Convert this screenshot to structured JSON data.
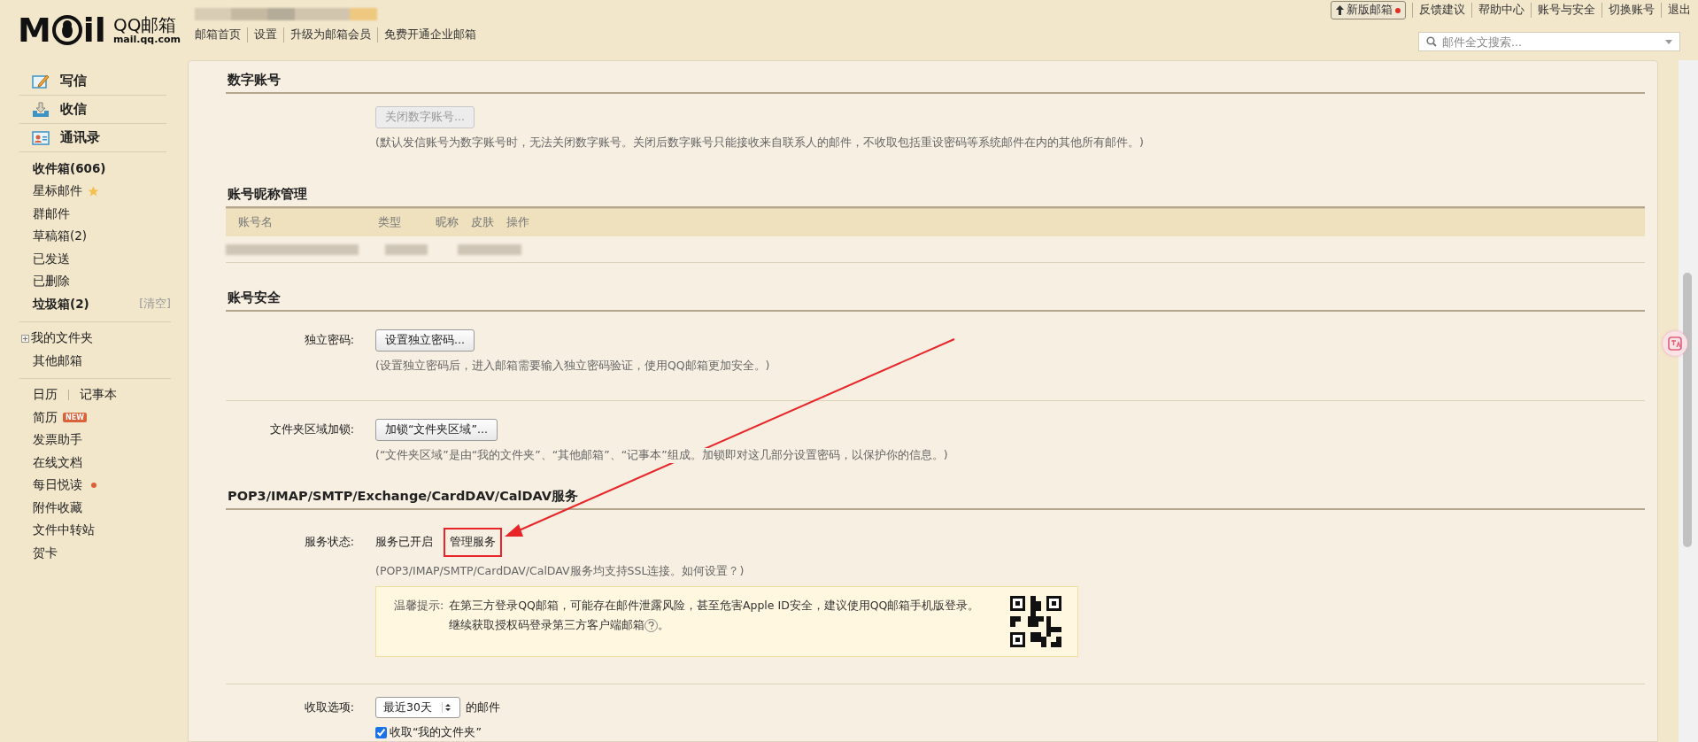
{
  "header": {
    "logo": {
      "letters_left": "M",
      "letters_right": "il",
      "name": "QQ邮箱",
      "domain": "mail.qq.com"
    },
    "nav_links": [
      "邮箱首页",
      "设置",
      "升级为邮箱会员",
      "免费开通企业邮箱"
    ],
    "new_version_button": {
      "label": "新版邮箱",
      "notify": true
    },
    "top_links": [
      "反馈建议",
      "帮助中心",
      "账号与安全",
      "切换账号",
      "退出"
    ],
    "search": {
      "placeholder": "邮件全文搜索..."
    }
  },
  "sidebar": {
    "actions": [
      {
        "label": "写信",
        "kind": "compose"
      },
      {
        "label": "收信",
        "kind": "inbox"
      },
      {
        "label": "通讯录",
        "kind": "contacts"
      }
    ],
    "folders": [
      {
        "label": "收件箱(606)",
        "unread": true,
        "starred": false
      },
      {
        "label": "星标邮件",
        "unread": false,
        "starred": true
      },
      {
        "label": "群邮件",
        "unread": false,
        "starred": false
      },
      {
        "label": "草稿箱(2)",
        "unread": false,
        "starred": false
      },
      {
        "label": "已发送",
        "unread": false,
        "starred": false
      },
      {
        "label": "已删除",
        "unread": false,
        "starred": false
      },
      {
        "label": "垃圾箱(2)",
        "unread": true,
        "starred": false,
        "action": "[清空]"
      }
    ],
    "my_folders": {
      "label": "我的文件夹",
      "expanded": false
    },
    "other_mail": "其他邮箱",
    "calendar_links": [
      "日历",
      "记事本"
    ],
    "tools": [
      {
        "label": "简历",
        "badge": "NEW",
        "notify": false
      },
      {
        "label": "发票助手",
        "notify": false
      },
      {
        "label": "在线文档",
        "notify": false
      },
      {
        "label": "每日悦读",
        "notify": true
      },
      {
        "label": "附件收藏",
        "notify": false
      },
      {
        "label": "文件中转站",
        "notify": false
      },
      {
        "label": "贺卡",
        "notify": false
      }
    ]
  },
  "content": {
    "digital_account": {
      "title": "数字账号",
      "button": {
        "label": "关闭数字账号...",
        "disabled": true
      },
      "note": "(默认发信账号为数字账号时，无法关闭数字账号。关闭后数字账号只能接收来自联系人的邮件，不收取包括重设密码等系统邮件在内的其他所有邮件。)"
    },
    "nickname": {
      "title": "账号昵称管理",
      "columns": [
        "账号名",
        "类型",
        "昵称",
        "皮肤",
        "操作"
      ]
    },
    "security": {
      "title": "账号安全",
      "rows": [
        {
          "label": "独立密码:",
          "button": {
            "label": "设置独立密码...",
            "disabled": false
          },
          "note": "(设置独立密码后，进入邮箱需要输入独立密码验证，使用QQ邮箱更加安全。)"
        },
        {
          "label": "文件夹区域加锁:",
          "button": {
            "label": "加锁“文件夹区域”...",
            "disabled": false
          },
          "note": "(“文件夹区域”是由“我的文件夹”、“其他邮箱”、“记事本”组成。加锁即对这几部分设置密码，以保护你的信息。)"
        }
      ]
    },
    "services": {
      "title": "POP3/IMAP/SMTP/Exchange/CardDAV/CalDAV服务",
      "status_label": "服务状态:",
      "status_value": "服务已开启",
      "manage_link": "管理服务",
      "note": "(POP3/IMAP/SMTP/CardDAV/CalDAV服务均支持SSL连接。如何设置？)",
      "tip": {
        "label": "温馨提示:",
        "line_1": "在第三方登录QQ邮箱，可能存在邮件泄露风险，甚至危害Apple ID安全，建议使用QQ邮箱手机版登录。",
        "line_2": "继续获取授权码登录第三方客户端邮箱",
        "line_2_end": "。"
      },
      "fetch": {
        "label": "收取选项:",
        "select_value": "最近30天",
        "suffix": "的邮件",
        "checkbox": {
          "label": "收取“我的文件夹”",
          "checked": true
        }
      }
    }
  }
}
